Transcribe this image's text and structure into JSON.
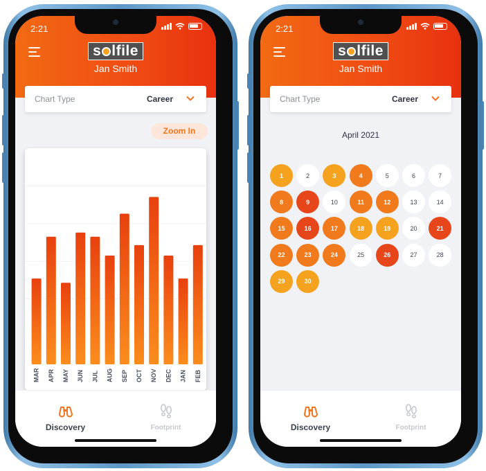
{
  "status_time": "2:21",
  "app_name": "solfile",
  "logo_pre": "s",
  "logo_post": "lfile",
  "user_name": "Jan Smith",
  "chart_type": {
    "label": "Chart Type",
    "value": "Career"
  },
  "zoom_label": "Zoom In",
  "chart_data": {
    "type": "bar",
    "categories": [
      "MAR",
      "APR",
      "MAY",
      "JUN",
      "JUL",
      "AUG",
      "SEP",
      "OCT",
      "NOV",
      "DEC",
      "JAN",
      "FEB"
    ],
    "values": [
      41,
      61,
      39,
      63,
      61,
      52,
      72,
      57,
      80,
      52,
      41,
      57
    ],
    "ylim": [
      0,
      100
    ],
    "title": "",
    "xlabel": "",
    "ylabel": "",
    "grid": true,
    "colors": {
      "bar_top": "#e8400e",
      "bar_bottom": "#fb8d1d"
    }
  },
  "calendar": {
    "month": "April 2021",
    "days": [
      {
        "d": "1",
        "level": 1
      },
      {
        "d": "2",
        "level": 0
      },
      {
        "d": "3",
        "level": 1
      },
      {
        "d": "4",
        "level": 2
      },
      {
        "d": "5",
        "level": 0
      },
      {
        "d": "6",
        "level": 0
      },
      {
        "d": "7",
        "level": 0
      },
      {
        "d": "8",
        "level": 2
      },
      {
        "d": "9",
        "level": 3
      },
      {
        "d": "10",
        "level": 0
      },
      {
        "d": "11",
        "level": 2
      },
      {
        "d": "12",
        "level": 2
      },
      {
        "d": "13",
        "level": 0
      },
      {
        "d": "14",
        "level": 0
      },
      {
        "d": "15",
        "level": 2
      },
      {
        "d": "16",
        "level": 3
      },
      {
        "d": "17",
        "level": 2
      },
      {
        "d": "18",
        "level": 1
      },
      {
        "d": "19",
        "level": 1
      },
      {
        "d": "20",
        "level": 0
      },
      {
        "d": "21",
        "level": 3
      },
      {
        "d": "22",
        "level": 2
      },
      {
        "d": "23",
        "level": 2
      },
      {
        "d": "24",
        "level": 2
      },
      {
        "d": "25",
        "level": 0
      },
      {
        "d": "26",
        "level": 3
      },
      {
        "d": "27",
        "level": 0
      },
      {
        "d": "28",
        "level": 0
      },
      {
        "d": "29",
        "level": 1
      },
      {
        "d": "30",
        "level": 1
      }
    ]
  },
  "tabs": [
    {
      "label": "Discovery",
      "icon": "binoculars-icon",
      "active": true
    },
    {
      "label": "Footprint",
      "icon": "footprint-icon",
      "active": false
    }
  ],
  "colors": {
    "accent": "#f2741d",
    "header": "#f04a13"
  }
}
